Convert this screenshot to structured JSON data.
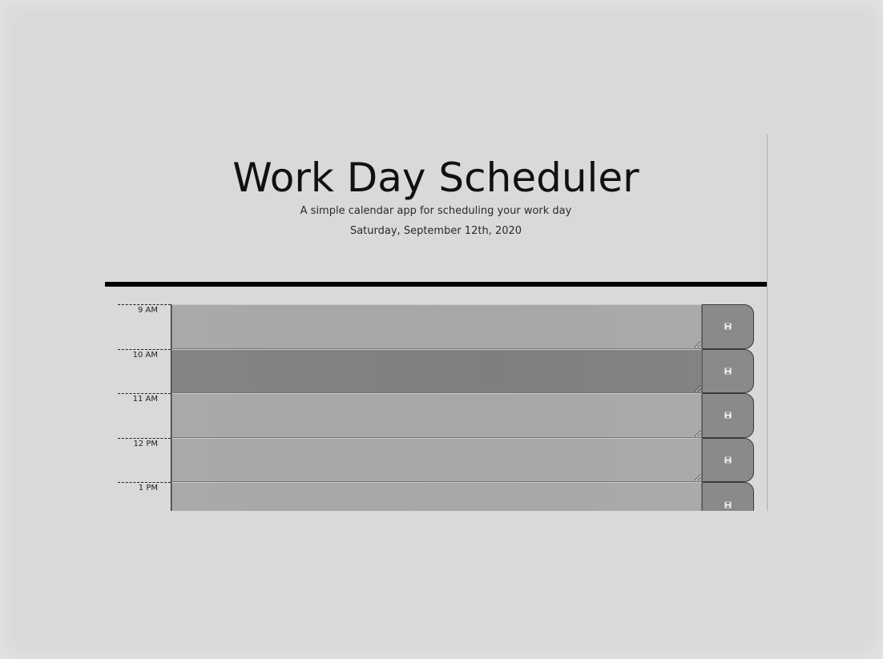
{
  "header": {
    "title": "Work Day Scheduler",
    "subtitle": "A simple calendar app for scheduling your work day",
    "current_day": "Saturday, September 12th, 2020"
  },
  "timeblocks": [
    {
      "hour": "9 AM",
      "text": "",
      "state": "past"
    },
    {
      "hour": "10 AM",
      "text": "",
      "state": "present"
    },
    {
      "hour": "11 AM",
      "text": "",
      "state": "past"
    },
    {
      "hour": "12 PM",
      "text": "",
      "state": "past"
    },
    {
      "hour": "1 PM",
      "text": "",
      "state": "past"
    }
  ],
  "icons": {
    "save": "floppy-disk-icon"
  },
  "colors": {
    "background": "#d9d9d9",
    "past_block": "#a9a9a9",
    "present_block": "#838383",
    "save_button": "#8a8a8a",
    "divider": "#000000"
  }
}
